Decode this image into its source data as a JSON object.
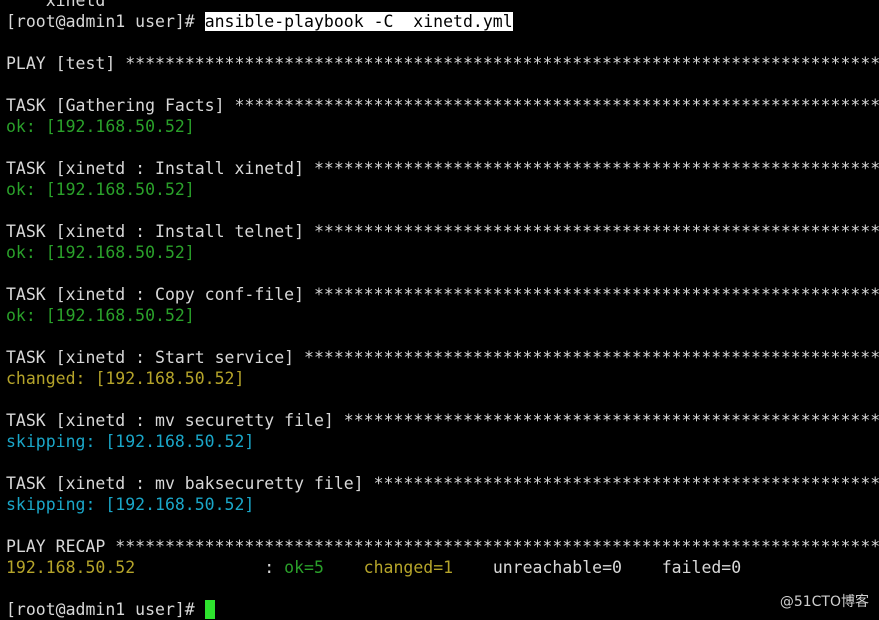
{
  "terminal": {
    "prev_line": "    xinetd",
    "prompt": "[root@admin1 user]# ",
    "command": "ansible-playbook -C  xinetd.yml",
    "play_header": "PLAY [test] ",
    "tasks": [
      {
        "title": "TASK [Gathering Facts] ",
        "status": "ok",
        "result": "ok: [192.168.50.52]"
      },
      {
        "title": "TASK [xinetd : Install xinetd] ",
        "status": "ok",
        "result": "ok: [192.168.50.52]"
      },
      {
        "title": "TASK [xinetd : Install telnet] ",
        "status": "ok",
        "result": "ok: [192.168.50.52]"
      },
      {
        "title": "TASK [xinetd : Copy conf-file] ",
        "status": "ok",
        "result": "ok: [192.168.50.52]"
      },
      {
        "title": "TASK [xinetd : Start service] ",
        "status": "changed",
        "result": "changed: [192.168.50.52]"
      },
      {
        "title": "TASK [xinetd : mv securetty file] ",
        "status": "skipping",
        "result": "skipping: [192.168.50.52]"
      },
      {
        "title": "TASK [xinetd : mv baksecuretty file] ",
        "status": "skipping",
        "result": "skipping: [192.168.50.52]"
      }
    ],
    "recap_header": "PLAY RECAP ",
    "recap": {
      "host": "192.168.50.52",
      "sep": ": ",
      "ok": "ok=5",
      "changed": "changed=1",
      "unreachable": "unreachable=0",
      "failed": "failed=0"
    },
    "final_prompt": "[root@admin1 user]# "
  },
  "watermark": "@51CTO博客",
  "colors": {
    "ok": "#2aa12a",
    "changed": "#b5a42a",
    "skipping": "#1aa7c9",
    "cursor": "#2ee32e"
  }
}
